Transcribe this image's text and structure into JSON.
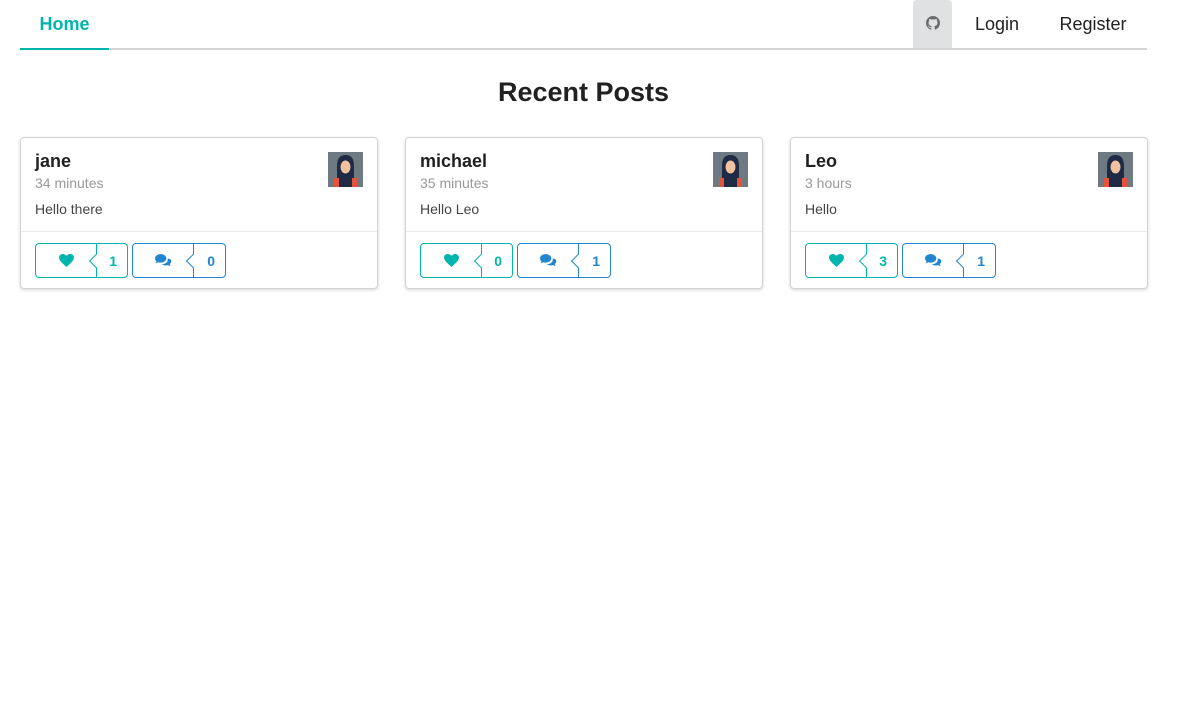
{
  "nav": {
    "home_label": "Home",
    "login_label": "Login",
    "register_label": "Register",
    "github_icon": "github-icon"
  },
  "page_title": "Recent Posts",
  "colors": {
    "accent": "#00b5ad",
    "comment": "#2185d0",
    "github_bg": "#e0e1e2"
  },
  "posts": [
    {
      "username": "jane",
      "time": "34 minutes",
      "body": "Hello there",
      "likes": "1",
      "comments": "0"
    },
    {
      "username": "michael",
      "time": "35 minutes",
      "body": "Hello Leo",
      "likes": "0",
      "comments": "1"
    },
    {
      "username": "Leo",
      "time": "3 hours",
      "body": "Hello",
      "likes": "3",
      "comments": "1"
    }
  ]
}
